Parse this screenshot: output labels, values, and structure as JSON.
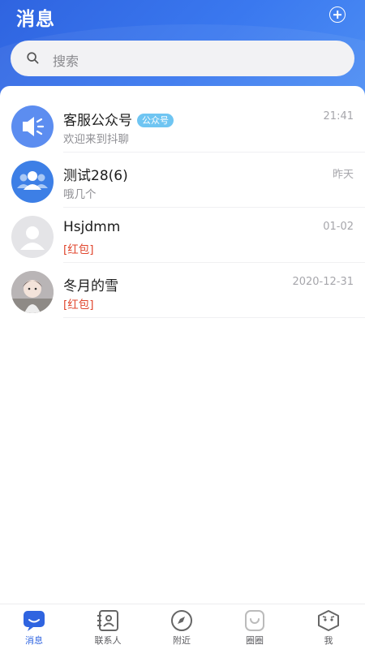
{
  "header": {
    "title": "消息"
  },
  "search": {
    "placeholder": "搜索"
  },
  "conversations": [
    {
      "name": "客服公众号",
      "badge": "公众号",
      "preview": "欢迎来到抖聊",
      "time": "21:41"
    },
    {
      "name": "测试28(6)",
      "preview": "哦几个",
      "time": "昨天"
    },
    {
      "name": "Hsjdmm",
      "preview": "[红包]",
      "time": "01-02"
    },
    {
      "name": "冬月的雪",
      "preview": "[红包]",
      "time": "2020-12-31"
    }
  ],
  "tabs": [
    {
      "label": "消息",
      "icon": "chat-bubble-icon",
      "active": true
    },
    {
      "label": "联系人",
      "icon": "contacts-book-icon"
    },
    {
      "label": "附近",
      "icon": "compass-icon"
    },
    {
      "label": "圈圈",
      "icon": "circle-moments-icon"
    },
    {
      "label": "我",
      "icon": "face-profile-icon"
    }
  ],
  "colors": {
    "brand": "#2f64e0",
    "red_packet": "#e0462d",
    "badge": "#6fc5f2"
  }
}
